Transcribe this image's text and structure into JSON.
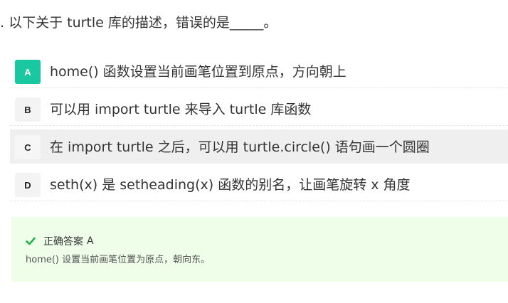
{
  "question": {
    "text": ". 以下关于 turtle 库的描述，错误的是_____。"
  },
  "options": [
    {
      "letter": "A",
      "text": "home() 函数设置当前画笔位置到原点，方向朝上"
    },
    {
      "letter": "B",
      "text": "可以用 import turtle 来导入 turtle 库函数"
    },
    {
      "letter": "C",
      "text": "在 import turtle 之后，可以用 turtle.circle() 语句画一个圆圈"
    },
    {
      "letter": "D",
      "text": "seth(x) 是 setheading(x) 函数的别名，让画笔旋转 x 角度"
    }
  ],
  "answer": {
    "label": "正确答案",
    "value": "A",
    "explanation": "home() 设置当前画笔位置为原点，朝向东。"
  },
  "colors": {
    "correct_badge": "#19c8a0",
    "selected_row": "#efefef",
    "answer_bg": "#eefee9",
    "check": "#22b14c"
  },
  "icons": {
    "answer_check": "check-icon"
  }
}
